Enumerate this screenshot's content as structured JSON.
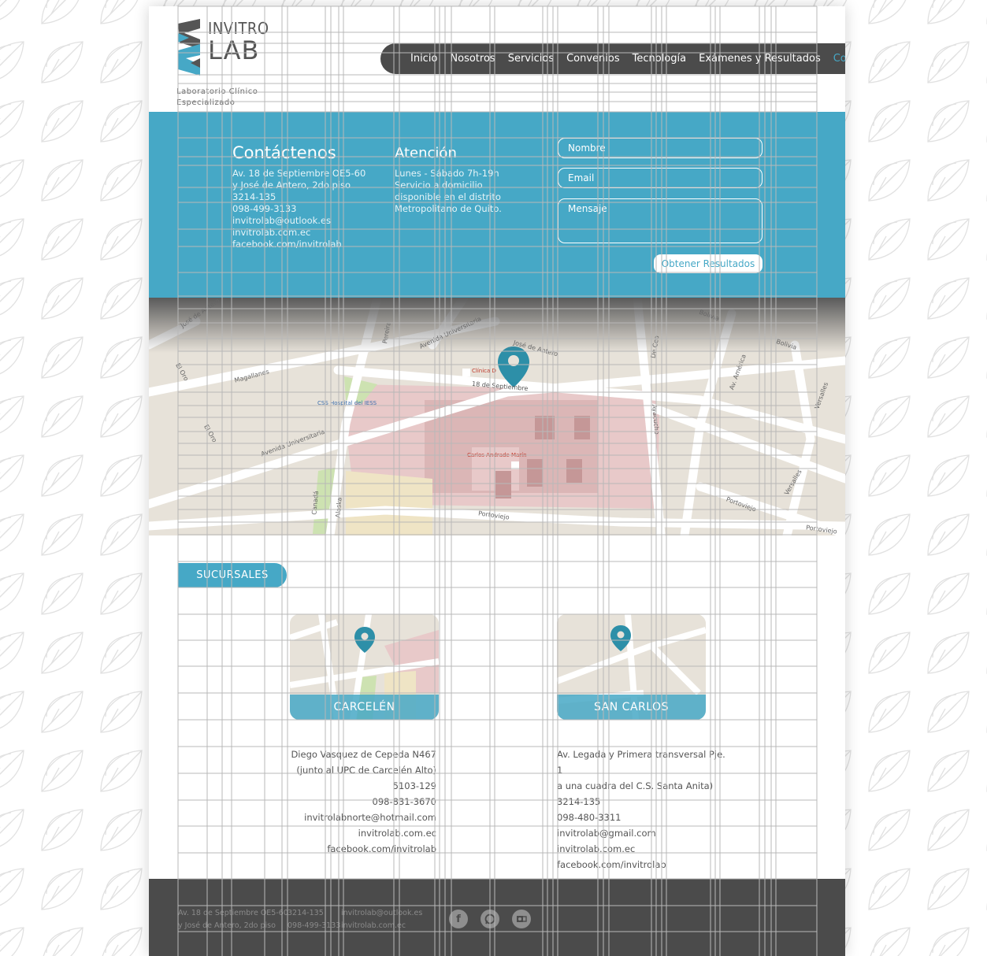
{
  "logo": {
    "word1": "INVITRO",
    "word2": "LAB"
  },
  "tagline": [
    "Laboratorio Clínico",
    "Especializado"
  ],
  "nav": [
    {
      "label": "Inicio",
      "active": false
    },
    {
      "label": "Nosotros",
      "active": false
    },
    {
      "label": "Servicios",
      "active": false
    },
    {
      "label": "Convenios",
      "active": false
    },
    {
      "label": "Tecnología",
      "active": false
    },
    {
      "label": "Exámenes y Resultados",
      "active": false
    },
    {
      "label": "Contacto",
      "active": true
    }
  ],
  "contact": {
    "title": "Contáctenos",
    "lines": [
      "Av. 18 de Septiembre OE5-60",
      "y José de Antero, 2do piso",
      "3214-135",
      "098-499-3133",
      "invitrolab@outlook.es",
      "invitrolab.com.ec",
      "facebook.com/invitrolab"
    ]
  },
  "attention": {
    "title": "Atención",
    "lines": [
      "Lunes - Sábado 7h-19h",
      "Servicio a domicilio",
      "disponible en el distrito",
      "Metropolitano de Quito."
    ]
  },
  "form": {
    "name_placeholder": "Nombre",
    "email_placeholder": "Email",
    "message_placeholder": "Mensaje",
    "submit_label": "Obtener Resultados"
  },
  "map": {
    "labels": {
      "jose_antero_left": "José de Antero",
      "jose_antero_right": "José de Antero",
      "av_universitaria_top": "Avenida Universitaria",
      "av_universitaria_bottom": "Avenida Universitaria",
      "magallanes": "Magallanes",
      "el_oro_top": "El Oro",
      "el_oro_bottom": "El Oro",
      "bolivia_top": "Bolivia",
      "bolivia_right": "Bolivia",
      "av_america": "Av. América",
      "versalles_top": "Versalles",
      "versalles_bottom": "Versalles",
      "portoviejo_center": "Portoviejo",
      "portoviejo_right": "Portoviejo",
      "portoviejo_far": "Portoviejo",
      "dieciocho": "18 de Septiembre",
      "canada": "Canadá",
      "alaska": "Alaska",
      "ayacucho": "Ayacucho",
      "de_ceo": "De Ceo",
      "pereira": "Pereira",
      "clinica": "Clínica D",
      "hospital": "Carlos Andrade Marín",
      "bus_stop": "CSS Hospital del IESS",
      "h": "H"
    }
  },
  "sucursales": {
    "title": "SUCURSALES",
    "branches": [
      {
        "name": "CARCELÉN",
        "lines": [
          "Diego Vasquez de Cepeda N467",
          "(junto al UPC de Carcelén Alto)",
          "5103-129",
          "098-831-3670",
          "invitrolabnorte@hotmail.com",
          "invitrolab.com.ec",
          "facebook.com/invitrolab"
        ]
      },
      {
        "name": "SAN CARLOS",
        "lines": [
          "Av. Legada y Primera transversal Pje. 1",
          "a una cuadra del C.S. Santa Anita)",
          "3214-135",
          "098-480-3311",
          "invitrolab@gmail.com",
          "invitrolab.com.ec",
          "facebook.com/invitrolab"
        ]
      }
    ]
  },
  "footer": {
    "col1": [
      "Av. 18 de Septiembre OE5-60",
      "y José de Antero, 2do piso"
    ],
    "col2": [
      "3214-135",
      "098-499-3133"
    ],
    "col3": [
      "invitrolab@outlook.es",
      "invitrolab.com.ec"
    ],
    "icons": [
      "facebook-icon",
      "whatsapp-icon",
      "outlook-icon"
    ]
  },
  "colors": {
    "accent": "#46a8c6",
    "dark": "#4b4b4b",
    "active_nav": "#46a8c6"
  }
}
